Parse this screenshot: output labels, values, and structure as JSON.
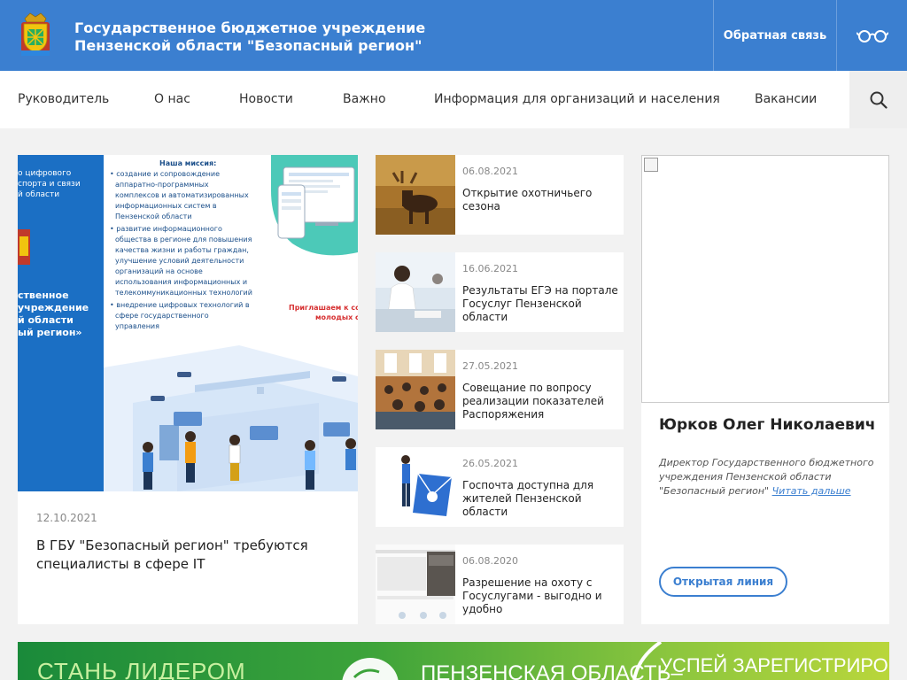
{
  "header": {
    "title": "Государственное бюджетное учреждение Пензенской области \"Безопасный регион\"",
    "feedback_label": "Обратная связь",
    "accessibility_icon": "glasses-icon",
    "logo_icon": "coat-of-arms-icon",
    "color": "#3b7fd0"
  },
  "nav": {
    "items": [
      {
        "label": "Руководитель"
      },
      {
        "label": "О нас"
      },
      {
        "label": "Новости"
      },
      {
        "label": "Важно"
      },
      {
        "label": "Информация для организаций и населения"
      },
      {
        "label": "Вакансии"
      }
    ],
    "search_icon": "search-icon"
  },
  "feature": {
    "image": {
      "left_lines": [
        "о цифрового",
        "спорта и связи",
        "й области",
        "ственное",
        "учреждение",
        "й области",
        "ый регион»"
      ],
      "mission_heading": "Наша миссия:",
      "mission_lines": [
        "• создание и сопровождение",
        "аппаратно-программных",
        "комплексов и автоматизированных",
        "информационных систем в",
        "Пензенской области",
        "• развитие информационного",
        "общества в регионе для повышения",
        "качества жизни и работы граждан,",
        "улучшение условий деятельности",
        "организаций на основе",
        "использования информационных и",
        "телекоммуникационных технологий",
        "• внедрение цифровых технологий в",
        "сфере государственного",
        "управления"
      ],
      "invite_lines": [
        "Приглашаем к со",
        "молодых специ"
      ]
    },
    "date": "12.10.2021",
    "title": "В ГБУ \"Безопасный регион\" требуются специалисты в сфере IT"
  },
  "news": [
    {
      "date": "06.08.2021",
      "title": "Открытие охотничьего сезона"
    },
    {
      "date": "16.06.2021",
      "title": "Результаты ЕГЭ на портале Госуслуг Пензенской области"
    },
    {
      "date": "27.05.2021",
      "title": "Совещание по вопросу реализации показателей Распоряжения"
    },
    {
      "date": "26.05.2021",
      "title": "Госпочта доступна для жителей Пензенской области"
    },
    {
      "date": "06.08.2020",
      "title": "Разрешение на охоту с Госуслугами - выгодно и удобно"
    }
  ],
  "director": {
    "name": "Юрков Олег Николаевич",
    "description": "Директор Государственного бюджетного учреждения Пензенской области \"Безопасный регион\"",
    "read_more": "Читать дальше",
    "hotline_label": "Открытая линия"
  },
  "banner": {
    "left_text": "СТАНЬ ЛИДЕРОМ",
    "middle_text": "ПЕНЗЕНСКАЯ ОБЛАСТЬ–",
    "right_text": "УСПЕЙ ЗАРЕГИСТРИРОВАТЬСЯ"
  }
}
